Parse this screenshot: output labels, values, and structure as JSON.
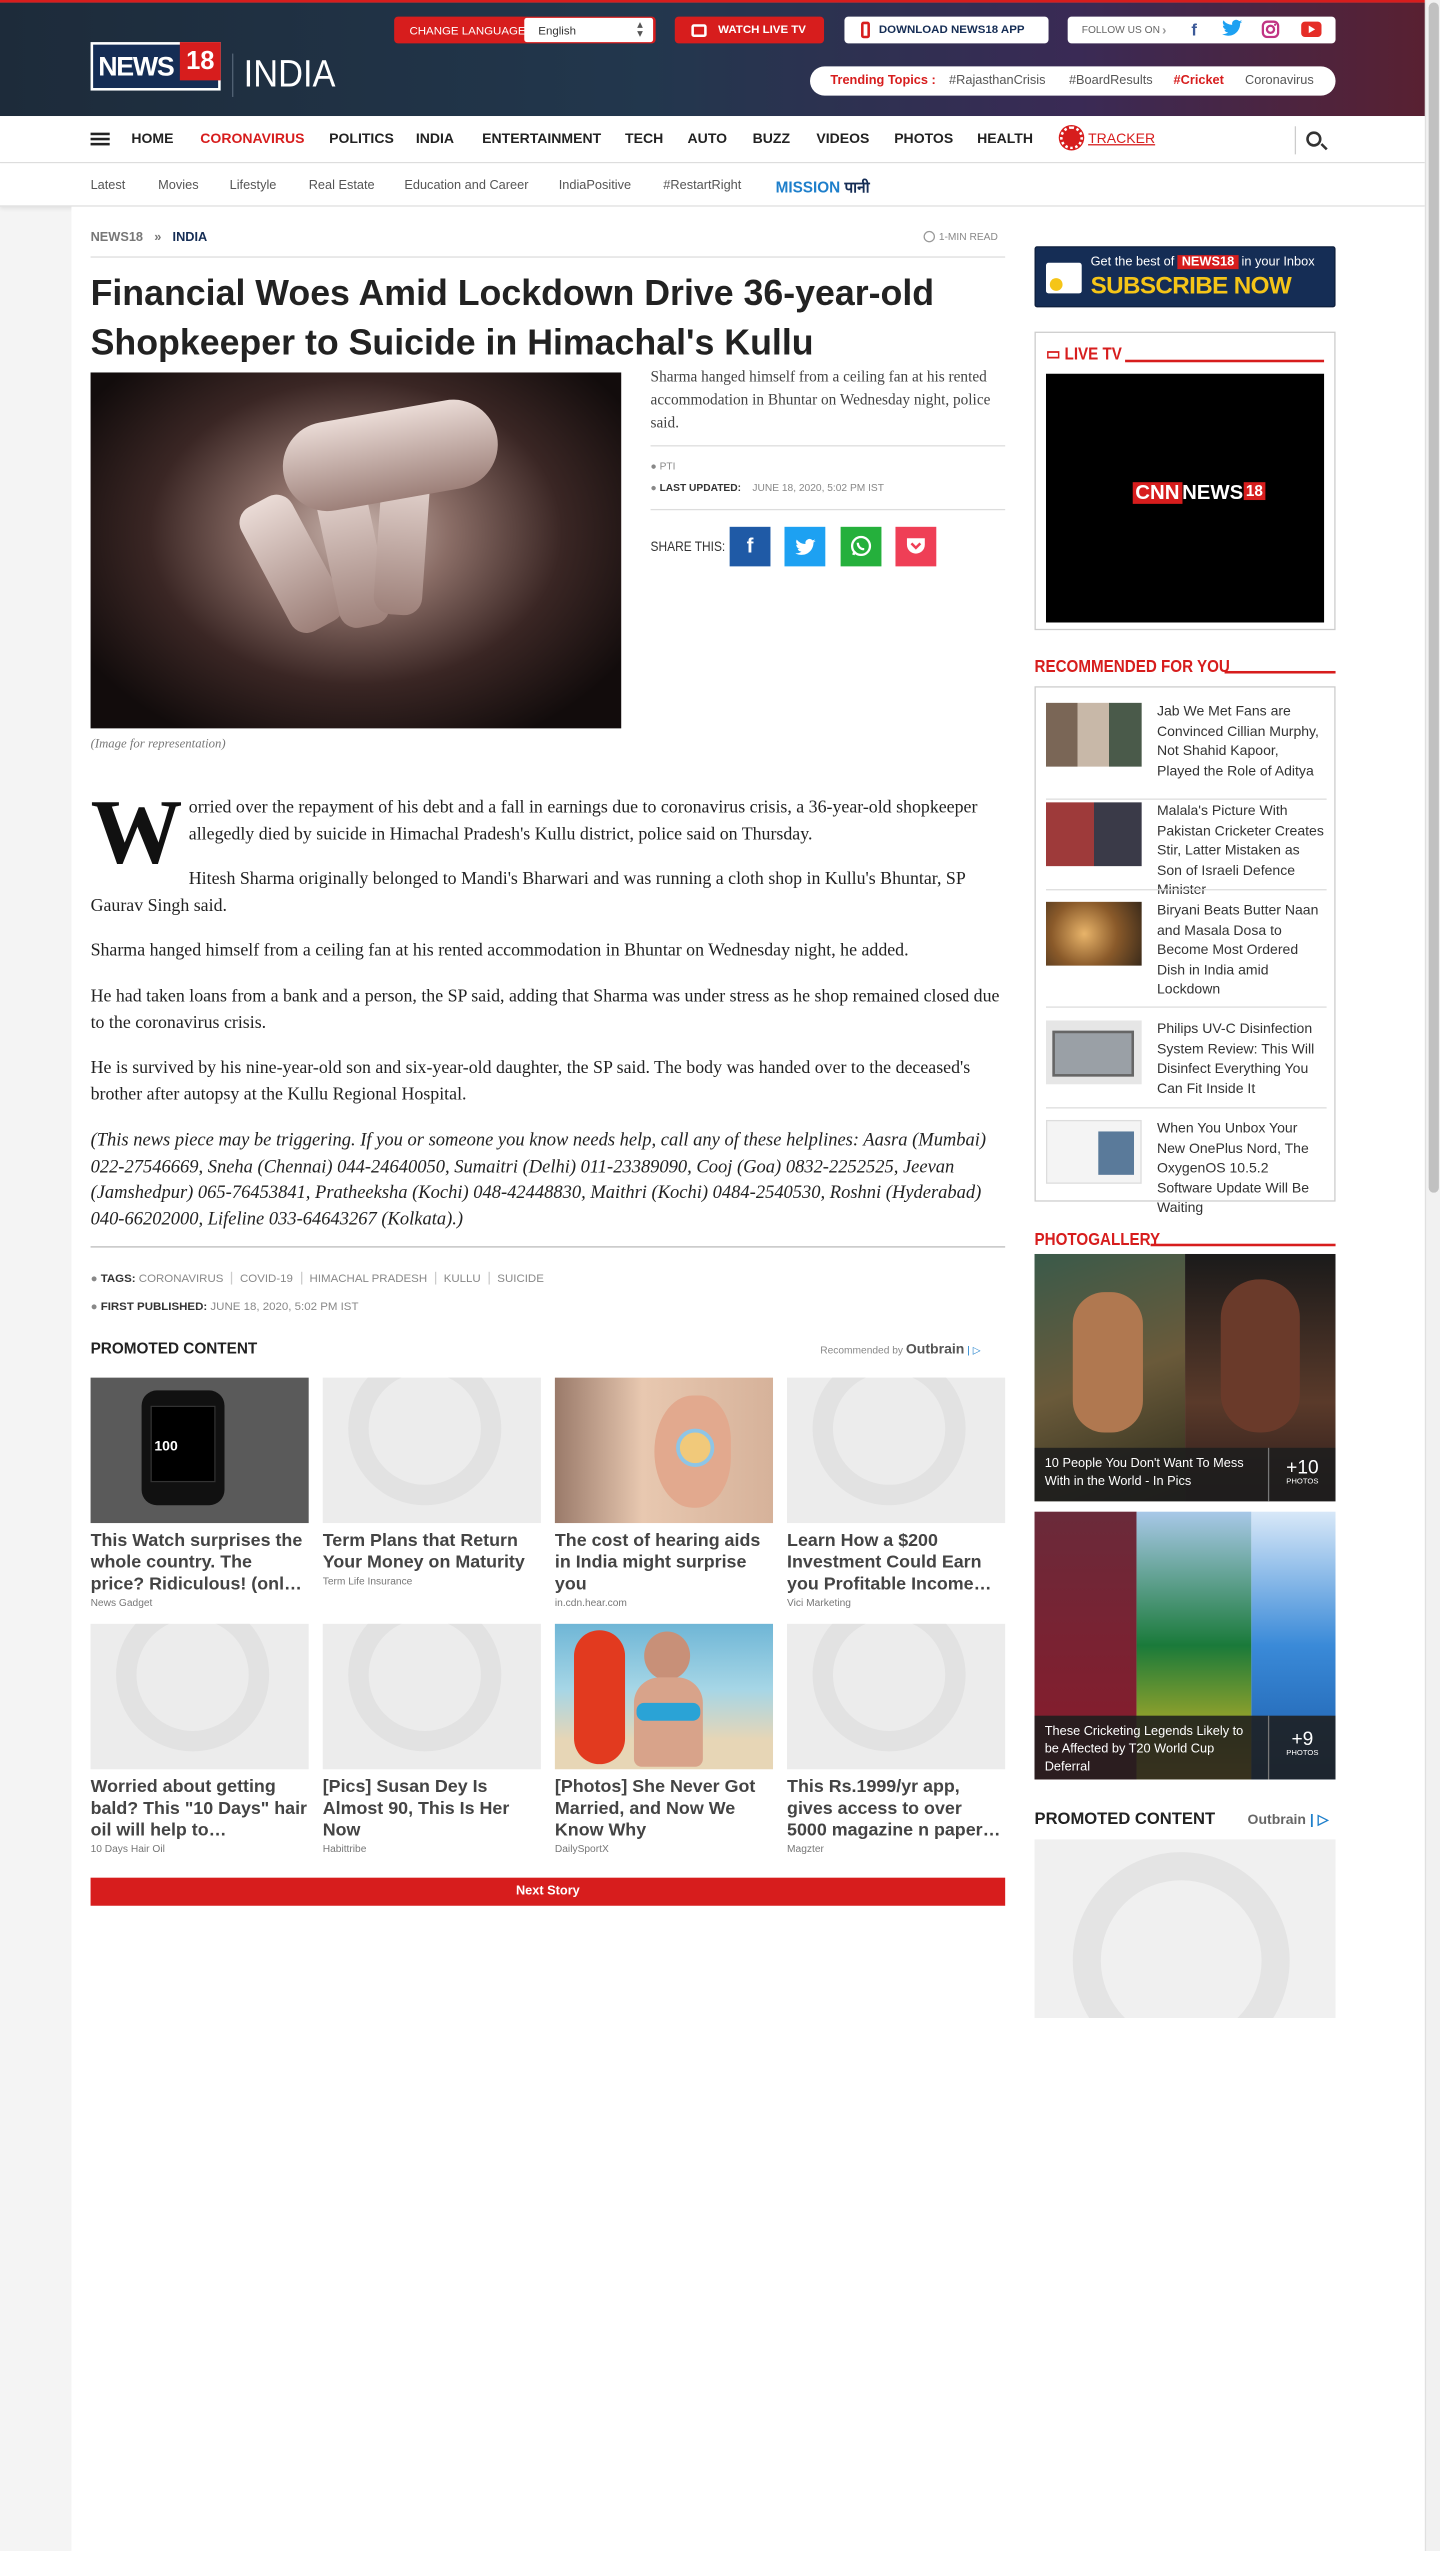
{
  "header": {
    "logo_text": "NEWS",
    "logo_badge": "18",
    "edition": "INDIA",
    "change_language_label": "CHANGE LANGUAGE",
    "language_value": "English",
    "watch_live": "WATCH LIVE TV",
    "download_app": "DOWNLOAD NEWS18 APP",
    "follow_us": "FOLLOW US ON",
    "trending_label": "Trending Topics :",
    "trending": [
      "#RajasthanCrisis",
      "#BoardResults",
      "#Cricket",
      "Coronavirus"
    ]
  },
  "nav": {
    "items": [
      "HOME",
      "CORONAVIRUS",
      "POLITICS",
      "INDIA",
      "ENTERTAINMENT",
      "TECH",
      "AUTO",
      "BUZZ",
      "VIDEOS",
      "PHOTOS",
      "HEALTH",
      "TRACKER"
    ],
    "active_color": "#d71d1d"
  },
  "subnav": {
    "items": [
      "Latest",
      "Movies",
      "Lifestyle",
      "Real Estate",
      "Education and Career",
      "IndiaPositive",
      "#RestartRight"
    ],
    "mission_a": "MISSION",
    "mission_b": "पानी"
  },
  "article": {
    "breadcrumb_home": "NEWS18",
    "breadcrumb_sep": "»",
    "breadcrumb_section": "INDIA",
    "read_time": "1-MIN READ",
    "title": "Financial Woes Amid Lockdown Drive 36-year-old Shopkeeper to Suicide in Himachal's Kullu",
    "image_caption": "(Image for representation)",
    "summary": "Sharma hanged himself from a ceiling fan at his rented accommodation in Bhuntar on Wednesday night, police said.",
    "source": "PTI",
    "last_updated_label": "LAST UPDATED:",
    "last_updated": "JUNE 18, 2020, 5:02 PM IST",
    "share_label": "SHARE THIS:",
    "drop_cap": "W",
    "para1": "orried over the repayment of his debt and a fall in earnings due to coronavirus crisis, a 36-year-old shopkeeper allegedly died by suicide in Himachal Pradesh's Kullu district, police said on Thursday.",
    "para2": "Hitesh Sharma originally belonged to Mandi's Bharwari and was running a cloth shop in Kullu's Bhuntar, SP Gaurav Singh said.",
    "para3": "Sharma hanged himself from a ceiling fan at his rented accommodation in Bhuntar on Wednesday night, he added.",
    "para4": "He had taken loans from a bank and a person, the SP said, adding that Sharma was under stress as he shop remained closed due to the coronavirus crisis.",
    "para5": "He is survived by his nine-year-old son and six-year-old daughter, the SP said. The body was handed over to the deceased's brother after autopsy at the Kullu Regional Hospital.",
    "para6": "(This news piece may be triggering. If you or someone you know needs help, call any of these helplines: Aasra (Mumbai) 022-27546669, Sneha (Chennai) 044-24640050, Sumaitri (Delhi) 011-23389090, Cooj (Goa) 0832-2252525, Jeevan (Jamshedpur) 065-76453841, Pratheeksha (Kochi) 048-42448830, Maithri (Kochi) 0484-2540530, Roshni (Hyderabad) 040-66202000, Lifeline 033-64643267 (Kolkata).)",
    "tags_label": "TAGS:",
    "tags": [
      "CORONAVIRUS",
      "COVID-19",
      "HIMACHAL PRADESH",
      "KULLU",
      "SUICIDE"
    ],
    "first_published_label": "FIRST PUBLISHED:",
    "first_published": "JUNE 18, 2020, 5:02 PM IST"
  },
  "promoted": {
    "heading": "PROMOTED CONTENT",
    "recommended_by": "Recommended by",
    "outbrain": "Outbrain",
    "cards": [
      {
        "title": "This Watch surprises the whole country. The price? Ridiculous! (onl…",
        "source": "News Gadget"
      },
      {
        "title": "Term Plans that Return Your Money on Maturity",
        "source": "Term Life Insurance"
      },
      {
        "title": "The cost of hearing aids in India might surprise you",
        "source": "in.cdn.hear.com"
      },
      {
        "title": "Learn How a $200 Investment Could Earn you Profitable Income…",
        "source": "Vici Marketing"
      },
      {
        "title": "Worried about getting bald? This \"10 Days\" hair oil will help to…",
        "source": "10 Days Hair Oil"
      },
      {
        "title": "[Pics] Susan Dey Is Almost 90, This Is Her Now",
        "source": "Habittribe"
      },
      {
        "title": "[Photos] She Never Got Married, and Now We Know Why",
        "source": "DailySportX"
      },
      {
        "title": "This Rs.1999/yr app, gives access to over 5000 magazine n paper…",
        "source": "Magzter"
      }
    ],
    "next_story": "Next Story"
  },
  "sidebar": {
    "subscribe_top": "Get the best of",
    "subscribe_brand": "NEWS18",
    "subscribe_tail": "in your Inbox",
    "subscribe_cta": "SUBSCRIBE NOW",
    "live_tv": "LIVE TV",
    "live_channel_a": "CNN",
    "live_channel_b": "NEWS",
    "live_channel_c": "18",
    "recommended_heading": "RECOMMENDED FOR YOU",
    "recommended": [
      "Jab We Met Fans are Convinced Cillian Murphy, Not Shahid Kapoor, Played the Role of Aditya",
      "Malala's Picture With Pakistan Cricketer Creates Stir, Latter Mistaken as Son of Israeli Defence Minister",
      "Biryani Beats Butter Naan and Masala Dosa to Become Most Ordered Dish in India amid Lockdown",
      "Philips UV-C Disinfection System Review: This Will Disinfect Everything You Can Fit Inside It",
      "When You Unbox Your New OnePlus Nord, The OxygenOS 10.5.2 Software Update Will Be Waiting"
    ],
    "photogallery_heading": "PHOTOGALLERY",
    "galleries": [
      {
        "caption": "10 People You Don't Want To Mess With in the World - In Pics",
        "count": "+10",
        "unit": "PHOTOS"
      },
      {
        "caption": "These Cricketing Legends Likely to be Affected by T20 World Cup Deferral",
        "count": "+9",
        "unit": "PHOTOS"
      }
    ],
    "promoted_heading": "PROMOTED CONTENT",
    "outbrain": "Outbrain"
  }
}
